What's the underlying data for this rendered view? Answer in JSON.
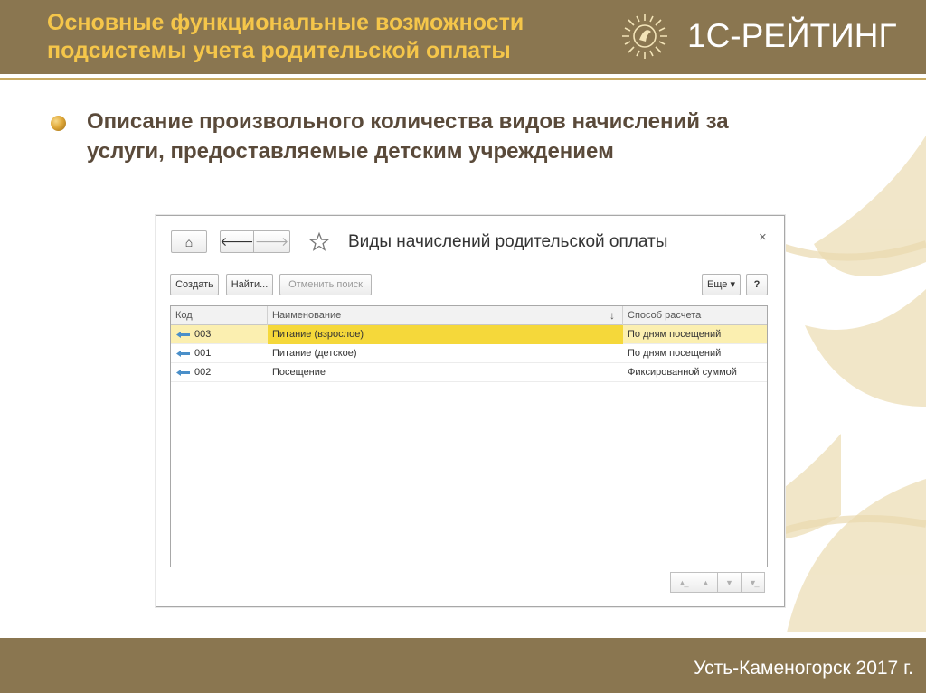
{
  "slide": {
    "title_lines": [
      "Основные функциональные возможности",
      "подсистемы учета родительской оплаты"
    ],
    "brand": "1С-РЕЙТИНГ",
    "bullet_lines": [
      "Описание произвольного количества видов начислений за",
      "услуги, предоставляемые детским учреждением"
    ],
    "footer": "Усть-Каменогорск 2017 г.",
    "colors": {
      "header_bg": "#8a7650",
      "title": "#f5c64a",
      "bullet_text": "#5a4a3a",
      "selected_row": "#f5d83a"
    }
  },
  "window": {
    "title": "Виды начислений родительской оплаты",
    "nav": {
      "home_icon": "home-icon",
      "back_icon": "arrow-left-icon",
      "forward_icon": "arrow-right-icon",
      "favorite_icon": "star-icon",
      "close_icon": "close-icon",
      "home_glyph": "⌂",
      "back_glyph": "🡐",
      "forward_glyph": "🡒",
      "close_glyph": "×"
    },
    "toolbar": {
      "create": "Создать",
      "find": "Найти...",
      "cancel_search": "Отменить поиск",
      "more": "Еще ▾",
      "help": "?"
    },
    "columns": {
      "code": "Код",
      "name": "Наименование",
      "name_sort": "↓",
      "method": "Способ расчета"
    },
    "rows": [
      {
        "code": "003",
        "name": "Питание (взрослое)",
        "method": "По дням посещений",
        "selected": true
      },
      {
        "code": "001",
        "name": "Питание (детское)",
        "method": "По дням посещений",
        "selected": false
      },
      {
        "code": "002",
        "name": "Посещение",
        "method": "Фиксированной суммой",
        "selected": false
      }
    ],
    "scroll_buttons": [
      "▲̲",
      "▲",
      "▼",
      "▼̲"
    ]
  }
}
